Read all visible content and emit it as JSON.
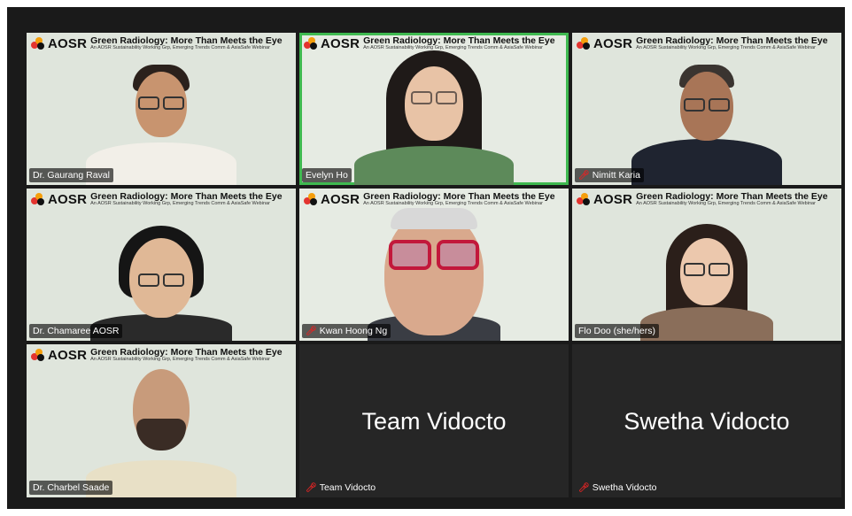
{
  "banner": {
    "logo": "AOSR",
    "title": "Green Radiology: More Than Meets the Eye",
    "subtitle": "An AOSR Sustainability Working Grp, Emerging Trends Comm & AsiaSafe Webinar"
  },
  "participants": [
    {
      "name": "Dr. Gaurang Raval",
      "muted": false,
      "active": false
    },
    {
      "name": "Evelyn Ho",
      "muted": false,
      "active": true
    },
    {
      "name": "Nimitt Karia",
      "muted": true,
      "active": false
    },
    {
      "name": "Dr. Chamaree AOSR",
      "muted": false,
      "active": false
    },
    {
      "name": "Kwan Hoong Ng",
      "muted": true,
      "active": false
    },
    {
      "name": "Flo Doo (she/hers)",
      "muted": false,
      "active": false
    },
    {
      "name": "Dr. Charbel Saade",
      "muted": false,
      "active": false
    },
    {
      "name": "Team Vidocto",
      "display": "Team Vidocto",
      "muted": true,
      "video_off": true
    },
    {
      "name": "Swetha Vidocto",
      "display": "Swetha Vidocto",
      "muted": true,
      "video_off": true
    }
  ],
  "colors": {
    "active_border": "#3fb950",
    "mute_icon": "#e02424",
    "background": "#1a1a1a"
  },
  "icons": {
    "muted": "mic-off-icon"
  }
}
